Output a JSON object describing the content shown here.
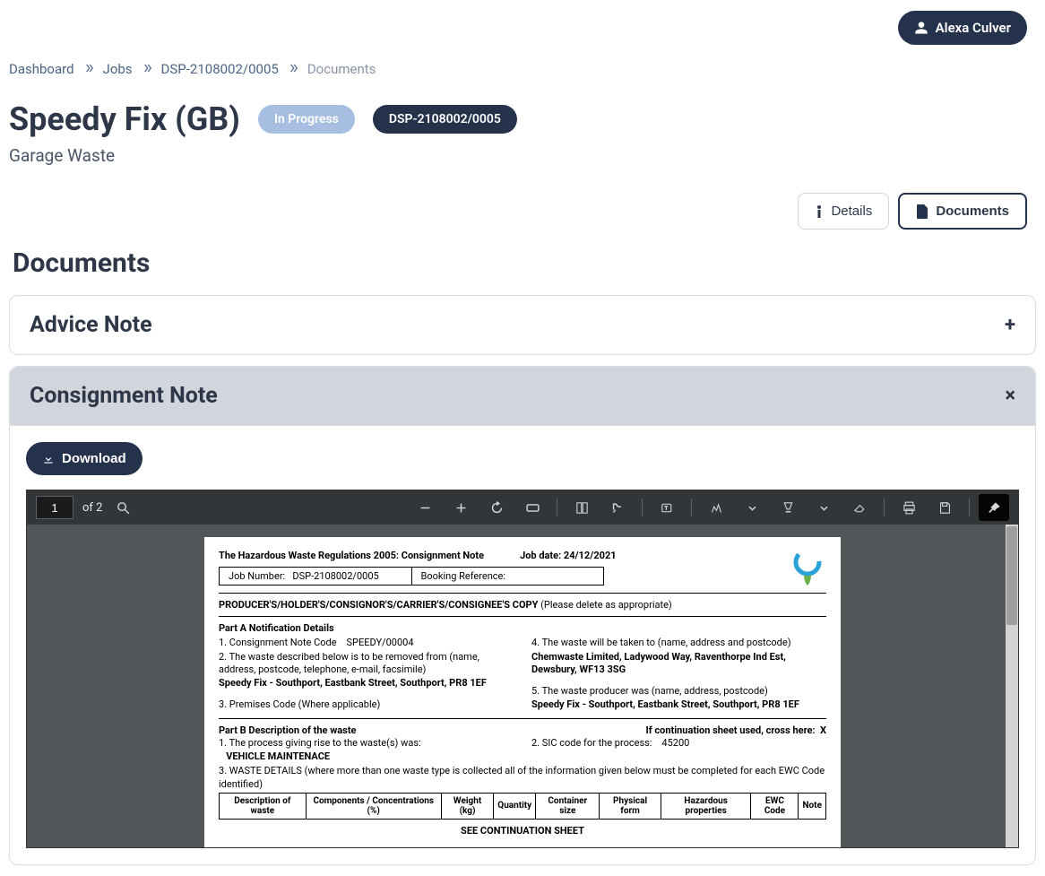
{
  "user": {
    "name": "Alexa Culver"
  },
  "breadcrumb": [
    {
      "label": "Dashboard"
    },
    {
      "label": "Jobs"
    },
    {
      "label": "DSP-2108002/0005"
    }
  ],
  "breadcrumb_current": "Documents",
  "page": {
    "title": "Speedy Fix (GB)",
    "status": "In Progress",
    "job_number": "DSP-2108002/0005",
    "subtitle": "Garage Waste"
  },
  "tabs": {
    "details": "Details",
    "documents": "Documents"
  },
  "section_heading": "Documents",
  "accordions": {
    "advice": {
      "title": "Advice Note"
    },
    "consignment": {
      "title": "Consignment Note"
    }
  },
  "download_label": "Download",
  "pdf": {
    "page_current": "1",
    "page_total": "of 2"
  },
  "doc": {
    "heading": "The Hazardous Waste Regulations 2005: Consignment Note",
    "job_date_label": "Job date: 24/12/2021",
    "job_number_label": "Job Number:",
    "job_number_value": "DSP-2108002/0005",
    "booking_ref_label": "Booking Reference:",
    "copies_line": "PRODUCER'S/HOLDER'S/CONSIGNOR'S/CARRIER'S/CONSIGNEE'S COPY",
    "copies_note": "(Please delete as appropriate)",
    "partA": "Part A  Notification Details",
    "a1": "1. Consignment Note Code",
    "a1v": "SPEEDY/00004",
    "a2": "2.  The waste described below is to be removed from (name, address, postcode, telephone, e-mail, facsimile)",
    "a2v": "Speedy Fix - Southport, Eastbank Street, Southport, PR8 1EF",
    "a3": "3. Premises Code (Where applicable)",
    "a4": "4. The waste will be taken to (name, address and postcode)",
    "a4v": "Chemwaste Limited, Ladywood Way,  Raventhorpe Ind Est, Dewsbury, WF13 3SG",
    "a5": "5. The waste producer was (name, address, postcode)",
    "a5v": "Speedy Fix - Southport, Eastbank Street, Southport, PR8 1EF",
    "partB": "Part B  Description of the waste",
    "cont_label": "If continuation sheet used, cross here:",
    "cont_mark": "X",
    "b1": "1. The process giving rise to the waste(s) was:",
    "b1v": "VEHICLE MAINTENACE",
    "b2": "2. SIC code for the process:",
    "b2v": "45200",
    "b3": "3. WASTE DETAILS (where more than one waste type is collected all of the information given below must be completed for each EWC Code identified)",
    "table_headers": [
      "Description of waste",
      "Components / Concentrations (%)",
      "Weight (kg)",
      "Quantity",
      "Container size",
      "Physical form",
      "Hazardous properties",
      "EWC Code",
      "Note"
    ],
    "see_cont": "SEE CONTINUATION SHEET"
  }
}
